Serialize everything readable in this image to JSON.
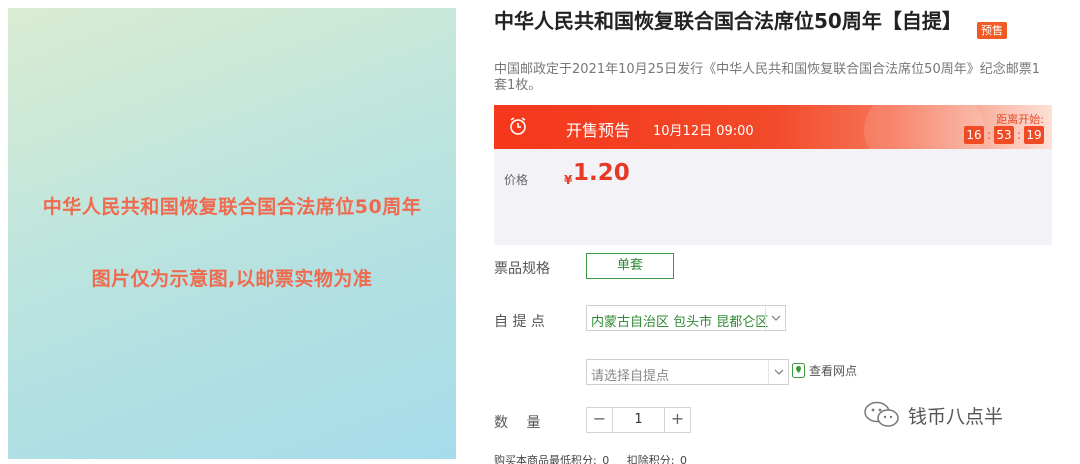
{
  "image": {
    "line1": "中华人民共和国恢复联合国合法席位50周年",
    "line2": "图片仅为示意图,以邮票实物为准"
  },
  "product": {
    "title": "中华人民共和国恢复联合国合法席位50周年【自提】",
    "badge": "预售",
    "subtitle": "中国邮政定于2021年10月25日发行《中华人民共和国恢复联合国合法席位50周年》纪念邮票1套1枚。"
  },
  "sale": {
    "label": "开售预告",
    "time": "10月12日 09:00",
    "countdown_label": "距离开始:",
    "countdown": [
      "16",
      "53",
      "19"
    ]
  },
  "price": {
    "label": "价格",
    "currency": "¥",
    "value": "1.20"
  },
  "spec": {
    "label": "票品规格",
    "option": "单套"
  },
  "pickup": {
    "label": "自 提 点",
    "region": "内蒙古自治区 包头市 昆都仑区",
    "point_placeholder": "请选择自提点",
    "view_points": "查看网点"
  },
  "quantity": {
    "label": "数　 量",
    "minus": "−",
    "value": "1",
    "plus": "+"
  },
  "points": {
    "min_label": "购买本商品最低积分:",
    "min_value": "0",
    "deduct_label": "扣除积分:",
    "deduct_value": "0"
  },
  "watermark": {
    "text": "钱币八点半",
    "icon": "wechat-icon"
  },
  "colors": {
    "accent_red": "#f5371b",
    "price_red": "#e63a27",
    "green": "#2f8a33"
  }
}
